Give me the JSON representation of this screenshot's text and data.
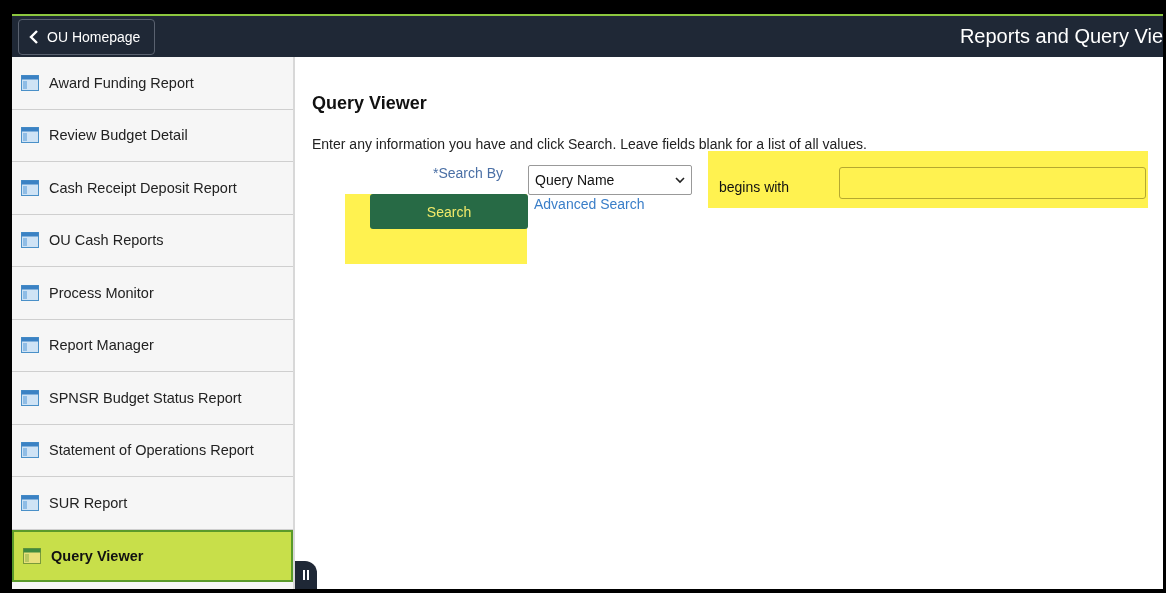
{
  "header": {
    "back_button": "OU Homepage",
    "title": "Reports and Query Vie"
  },
  "sidebar": {
    "items": [
      {
        "label": "Award Funding Report",
        "selected": false
      },
      {
        "label": "Review Budget Detail",
        "selected": false
      },
      {
        "label": "Cash Receipt Deposit Report",
        "selected": false
      },
      {
        "label": "OU Cash Reports",
        "selected": false
      },
      {
        "label": "Process Monitor",
        "selected": false
      },
      {
        "label": "Report Manager",
        "selected": false
      },
      {
        "label": "SPNSR Budget Status Report",
        "selected": false
      },
      {
        "label": "Statement of Operations Report",
        "selected": false
      },
      {
        "label": "SUR Report",
        "selected": false
      },
      {
        "label": "Query Viewer",
        "selected": true
      }
    ]
  },
  "content": {
    "heading": "Query Viewer",
    "instructions": "Enter any information you have and click Search. Leave fields blank for a list of all values.",
    "search_by_label": "*Search By",
    "search_by": "Query Name",
    "operator": "begins with",
    "search_button": "Search",
    "advanced_search_link": "Advanced Search"
  }
}
